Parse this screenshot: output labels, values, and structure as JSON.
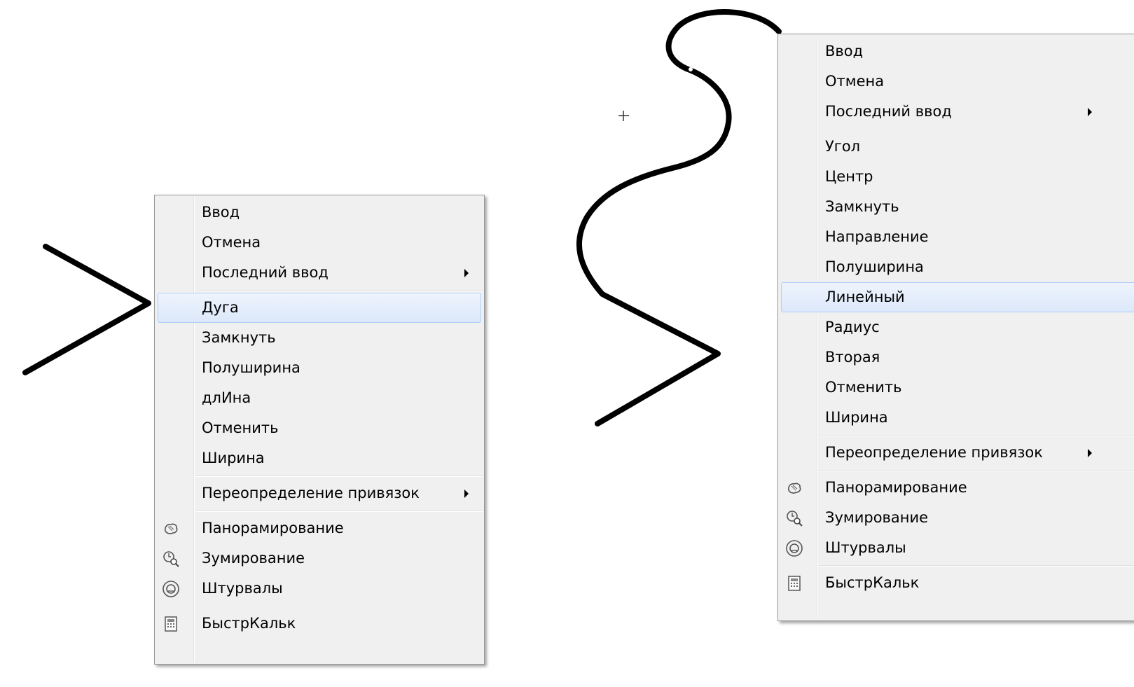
{
  "menu_left": {
    "items": [
      {
        "label": "Ввод"
      },
      {
        "label": "Отмена"
      },
      {
        "label": "Последний ввод"
      },
      {
        "label": "Дуга"
      },
      {
        "label": "Замкнуть"
      },
      {
        "label": "Полуширина"
      },
      {
        "label": "длИна"
      },
      {
        "label": "Отменить"
      },
      {
        "label": "Ширина"
      },
      {
        "label": "Переопределение привязок"
      },
      {
        "label": "Панорамирование",
        "icon": "pan-icon"
      },
      {
        "label": "Зумирование",
        "icon": "zoom-icon"
      },
      {
        "label": "Штурвалы",
        "icon": "steering-wheel-icon"
      },
      {
        "label": "БыстрКальк",
        "icon": "calculator-icon"
      }
    ],
    "highlighted": "Дуга"
  },
  "menu_right": {
    "items": [
      {
        "label": "Ввод"
      },
      {
        "label": "Отмена"
      },
      {
        "label": "Последний ввод"
      },
      {
        "label": "Угол"
      },
      {
        "label": "Центр"
      },
      {
        "label": "Замкнуть"
      },
      {
        "label": "Направление"
      },
      {
        "label": "Полуширина"
      },
      {
        "label": "Линейный"
      },
      {
        "label": "Радиус"
      },
      {
        "label": "Вторая"
      },
      {
        "label": "Отменить"
      },
      {
        "label": "Ширина"
      },
      {
        "label": "Переопределение привязок"
      },
      {
        "label": "Панорамирование",
        "icon": "pan-icon"
      },
      {
        "label": "Зумирование",
        "icon": "zoom-icon"
      },
      {
        "label": "Штурвалы",
        "icon": "steering-wheel-icon"
      },
      {
        "label": "БыстрКальк",
        "icon": "calculator-icon"
      }
    ],
    "highlighted": "Линейный"
  },
  "colors": {
    "menu_bg": "#f0f0f0",
    "highlight_border": "#aecff7",
    "polyline": "#000000"
  }
}
